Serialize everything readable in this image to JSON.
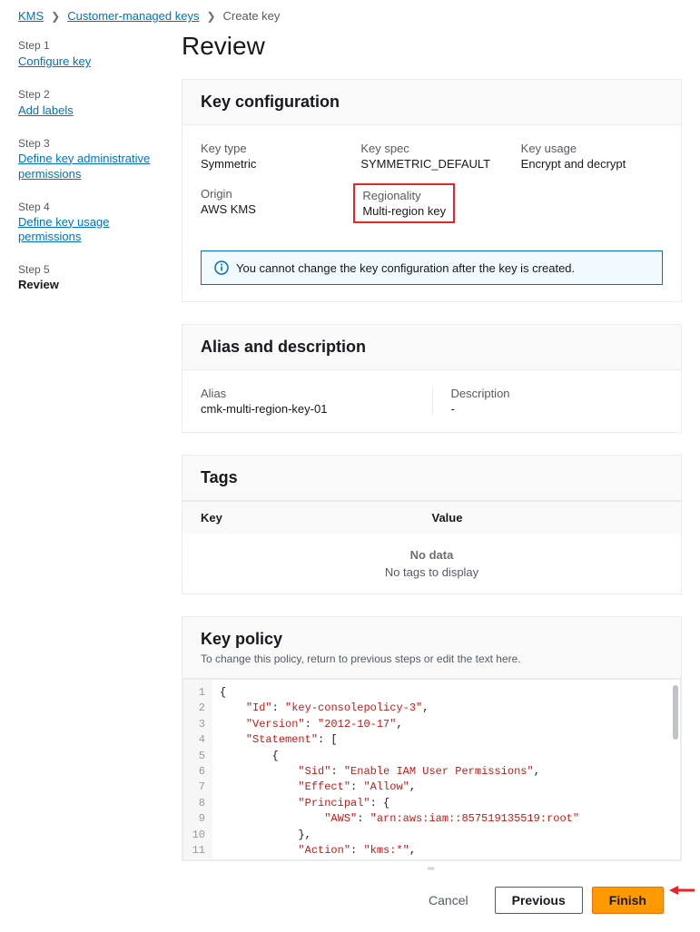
{
  "breadcrumb": {
    "kms": "KMS",
    "cmk": "Customer-managed keys",
    "current": "Create key"
  },
  "sidebar": {
    "steps": [
      {
        "label": "Step 1",
        "title": "Configure key"
      },
      {
        "label": "Step 2",
        "title": "Add labels"
      },
      {
        "label": "Step 3",
        "title": "Define key administrative permissions"
      },
      {
        "label": "Step 4",
        "title": "Define key usage permissions"
      },
      {
        "label": "Step 5",
        "title": "Review"
      }
    ]
  },
  "page_title": "Review",
  "key_config": {
    "heading": "Key configuration",
    "fields": {
      "key_type_label": "Key type",
      "key_type_value": "Symmetric",
      "key_spec_label": "Key spec",
      "key_spec_value": "SYMMETRIC_DEFAULT",
      "key_usage_label": "Key usage",
      "key_usage_value": "Encrypt and decrypt",
      "origin_label": "Origin",
      "origin_value": "AWS KMS",
      "regionality_label": "Regionality",
      "regionality_value": "Multi-region key"
    },
    "info": "You cannot change the key configuration after the key is created."
  },
  "alias": {
    "heading": "Alias and description",
    "alias_label": "Alias",
    "alias_value": "cmk-multi-region-key-01",
    "desc_label": "Description",
    "desc_value": "-"
  },
  "tags": {
    "heading": "Tags",
    "col_key": "Key",
    "col_value": "Value",
    "nodata_title": "No data",
    "nodata_sub": "No tags to display"
  },
  "policy": {
    "heading": "Key policy",
    "sub": "To change this policy, return to previous steps or edit the text here.",
    "code": {
      "Id": "key-consolepolicy-3",
      "Version": "2012-10-17",
      "Statement": [
        {
          "Sid": "Enable IAM User Permissions",
          "Effect": "Allow",
          "Principal": {
            "AWS": "arn:aws:iam::857519135519:root"
          },
          "Action": "kms:*",
          "Resource": "*"
        }
      ]
    }
  },
  "footer": {
    "cancel": "Cancel",
    "previous": "Previous",
    "finish": "Finish"
  }
}
